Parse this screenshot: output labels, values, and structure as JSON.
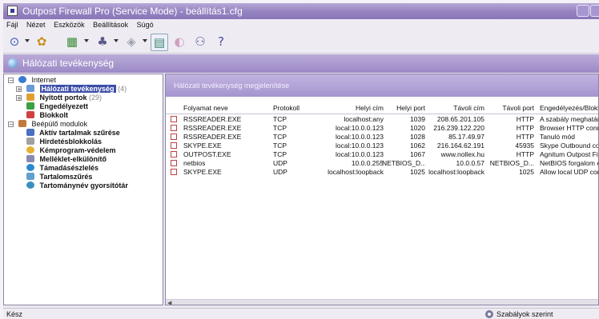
{
  "window": {
    "title": "Outpost Firewall Pro (Service Mode) - beállítás1.cfg"
  },
  "menu": [
    "Fájl",
    "Nézet",
    "Eszközök",
    "Beállítások",
    "Súgó"
  ],
  "section_header": "Hálózati tevékenység",
  "tree": [
    {
      "label": "Internet",
      "count": "",
      "level": 0,
      "selected": false,
      "bold": false
    },
    {
      "label": "Hálózati tevékenység",
      "count": "(4)",
      "level": 1,
      "selected": true,
      "bold": true
    },
    {
      "label": "Nyitott portok",
      "count": "(29)",
      "level": 1,
      "selected": false,
      "bold": true
    },
    {
      "label": "Engedélyezett",
      "count": "",
      "level": 1,
      "selected": false,
      "bold": true
    },
    {
      "label": "Blokkolt",
      "count": "",
      "level": 1,
      "selected": false,
      "bold": true
    },
    {
      "label": "Beépülő modulok",
      "count": "",
      "level": 0,
      "selected": false,
      "bold": false
    },
    {
      "label": "Aktív tartalmak szűrése",
      "count": "",
      "level": 1,
      "selected": false,
      "bold": true
    },
    {
      "label": "Hirdetésblokkolás",
      "count": "",
      "level": 1,
      "selected": false,
      "bold": true
    },
    {
      "label": "Kémprogram-védelem",
      "count": "",
      "level": 1,
      "selected": false,
      "bold": true
    },
    {
      "label": "Melléklet-elkülönítő",
      "count": "",
      "level": 1,
      "selected": false,
      "bold": true
    },
    {
      "label": "Támadásészlelés",
      "count": "",
      "level": 1,
      "selected": false,
      "bold": true
    },
    {
      "label": "Tartalomszűrés",
      "count": "",
      "level": 1,
      "selected": false,
      "bold": true
    },
    {
      "label": "Tartománynév gyorsítótár",
      "count": "",
      "level": 1,
      "selected": false,
      "bold": true
    }
  ],
  "main_header": "Hálózati tevékenység megjelenítése",
  "columns": [
    "Folyamat neve",
    "Protokoll",
    "Helyi cím",
    "Helyi port",
    "Távoli cím",
    "Távoli port",
    "Engedélyezés/Blokkol"
  ],
  "rows": [
    [
      "RSSREADER.EXE",
      "TCP",
      "localhost:any",
      "1039",
      "208.65.201.105",
      "HTTP",
      "A szabály meghatároz"
    ],
    [
      "RSSREADER.EXE",
      "TCP",
      "local:10.0.0.123",
      "1020",
      "216.239.122.220",
      "HTTP",
      "Browser HTTP connec"
    ],
    [
      "RSSREADER.EXE",
      "TCP",
      "local:10.0.0.123",
      "1028",
      "85.17.49.97",
      "HTTP",
      "Tanuló mód"
    ],
    [
      "SKYPE.EXE",
      "TCP",
      "local:10.0.0.123",
      "1062",
      "216.164.62.191",
      "45935",
      "Skype Outbound conn"
    ],
    [
      "OUTPOST.EXE",
      "TCP",
      "local:10.0.0.123",
      "1067",
      "www.nollex.hu",
      "HTTP",
      "Agnitum Outpost Firev"
    ],
    [
      "netbios",
      "UDP",
      "10.0.0.255",
      "NETBIOS_D...",
      "10.0.0.57",
      "NETBIOS_D...",
      "NetBIOS forgalom eng"
    ],
    [
      "SKYPE.EXE",
      "UDP",
      "localhost:loopback",
      "1025",
      "localhost:loopback",
      "1025",
      "Allow local UDP conne"
    ]
  ],
  "status": {
    "left": "Kész",
    "right": "Szabályok szerint"
  },
  "icons": [
    "help-circle-icon",
    "globe-icon",
    "network-icon",
    "users-icon",
    "plugin-icon",
    "table-view-icon",
    "history-icon",
    "connections-icon",
    "whats-this-icon"
  ]
}
